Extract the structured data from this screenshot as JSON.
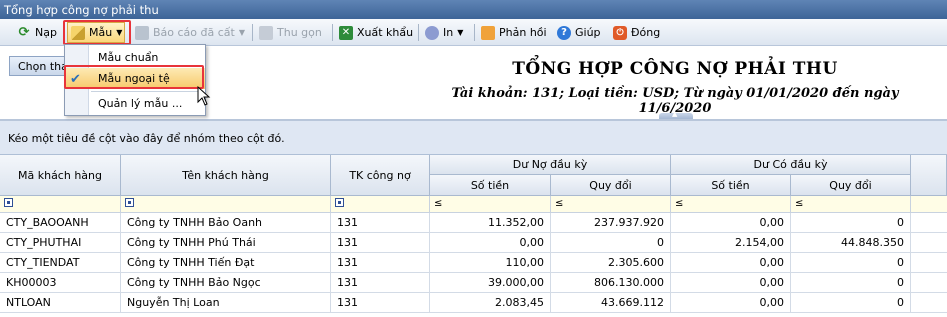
{
  "window": {
    "title": "Tổng hợp công nợ phải thu"
  },
  "toolbar": {
    "reload_label": "Nạp",
    "template_label": "Mẫu",
    "saved_reports_label": "Báo cáo đã cất",
    "compact_label": "Thu gọn",
    "export_label": "Xuất khẩu",
    "print_label": "In",
    "feedback_label": "Phản hồi",
    "help_label": "Giúp",
    "close_label": "Đóng",
    "icons": {
      "reload": "refresh-icon",
      "template": "template-icon",
      "saved": "save-icon",
      "compact": "compact-icon",
      "export": "excel-icon",
      "print": "printer-icon",
      "feedback": "mail-icon",
      "help": "help-icon",
      "close": "power-icon"
    }
  },
  "template_menu": {
    "items": [
      {
        "label": "Mẫu chuẩn",
        "checked": false
      },
      {
        "label": "Mẫu ngoại tệ",
        "checked": true
      },
      {
        "label": "Quản lý mẫu ..."
      }
    ]
  },
  "filter_button": {
    "label": "Chọn tha"
  },
  "report": {
    "title": "TỔNG HỢP CÔNG NỢ PHẢI THU",
    "subtitle": "Tài khoản: 131; Loại tiền: USD; Từ ngày 01/01/2020 đến ngày 11/6/2020"
  },
  "group_panel": {
    "hint": "Kéo một tiêu đề cột vào đây để nhóm theo cột đó."
  },
  "grid": {
    "headers": {
      "customer_code": "Mã khách hàng",
      "customer_name": "Tên khách hàng",
      "account": "TK công nợ",
      "opening_debit": "Dư Nợ đầu kỳ",
      "opening_credit": "Dư Có đầu kỳ",
      "amount": "Số tiền",
      "converted": "Quy đổi"
    },
    "filter_ops": [
      "≤",
      "≤",
      "≤",
      "≤"
    ],
    "rows": [
      {
        "code": "CTY_BAOOANH",
        "name": "Công ty TNHH Bảo Oanh",
        "account": "131",
        "debit_amount": "11.352,00",
        "debit_converted": "237.937.920",
        "credit_amount": "0,00",
        "credit_converted": "0"
      },
      {
        "code": "CTY_PHUTHAI",
        "name": "Công ty TNHH Phú Thái",
        "account": "131",
        "debit_amount": "0,00",
        "debit_converted": "0",
        "credit_amount": "2.154,00",
        "credit_converted": "44.848.350"
      },
      {
        "code": "CTY_TIENDAT",
        "name": "Công ty TNHH Tiến Đạt",
        "account": "131",
        "debit_amount": "110,00",
        "debit_converted": "2.305.600",
        "credit_amount": "0,00",
        "credit_converted": "0"
      },
      {
        "code": "KH00003",
        "name": "Công ty TNHH Bảo Ngọc",
        "account": "131",
        "debit_amount": "39.000,00",
        "debit_converted": "806.130.000",
        "credit_amount": "0,00",
        "credit_converted": "0"
      },
      {
        "code": "NTLOAN",
        "name": "Nguyễn Thị Loan",
        "account": "131",
        "debit_amount": "2.083,45",
        "debit_converted": "43.669.112",
        "credit_amount": "0,00",
        "credit_converted": "0"
      }
    ]
  },
  "colors": {
    "title_bar": "#3d6497",
    "highlight": "#e8343a",
    "selected_item": "#f7c96a",
    "group_panel": "#dfe7f3",
    "filter_row": "#fffde6"
  }
}
